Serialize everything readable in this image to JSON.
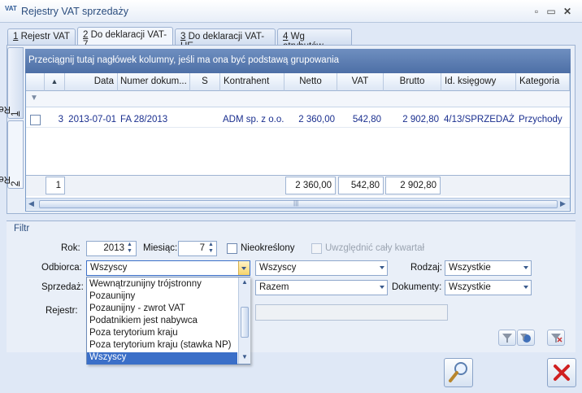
{
  "window": {
    "logo": "VAT",
    "title": "Rejestry VAT sprzedaży"
  },
  "tabs": [
    {
      "num": "1",
      "label": " Rejestr VAT"
    },
    {
      "num": "2",
      "label": " Do deklaracji VAT-7"
    },
    {
      "num": "3",
      "label": " Do deklaracji VAT-UE"
    },
    {
      "num": "4",
      "label": " Wg atrybutów"
    }
  ],
  "side_tabs": [
    {
      "num": "1",
      "label": " Rejestr zak."
    },
    {
      "num": "2",
      "label": " Rejestr spr."
    }
  ],
  "grid": {
    "group_hint": "Przeciągnij tutaj nagłówek kolumny, jeśli ma ona być podstawą grupowania",
    "sort_glyph": "▲",
    "columns": [
      "Data",
      "Numer dokum...",
      "S",
      "Kontrahent",
      "Netto",
      "VAT",
      "Brutto",
      "Id. księgowy",
      "Kategoria"
    ],
    "rows": [
      {
        "lp": "3",
        "data": "2013-07-01",
        "numer": "FA 28/2013",
        "s": "",
        "kontrahent": "ADM sp. z o.o.",
        "netto": "2 360,00",
        "vat": "542,80",
        "brutto": "2 902,80",
        "id": "4/13/SPRZEDAŻ",
        "kategoria": "Przychody"
      }
    ],
    "summary": {
      "count": "1",
      "netto": "2 360,00",
      "vat": "542,80",
      "brutto": "2 902,80"
    }
  },
  "filter": {
    "title": "Filtr",
    "rok_label": "Rok:",
    "rok_value": "2013",
    "miesiac_label": "Miesiąc:",
    "miesiac_value": "7",
    "nieokreslony_label": "Nieokreślony",
    "kwartal_label": "Uwzględnić cały kwartał",
    "odbiorca_label": "Odbiorca:",
    "odbiorca_value": "Wszyscy",
    "odbiorca2_value": "Wszyscy",
    "rodzaj_label": "Rodzaj:",
    "rodzaj_value": "Wszystkie",
    "sprzedaz_label": "Sprzedaż:",
    "razem_value": "Razem",
    "dokumenty_label": "Dokumenty:",
    "dokumenty_value": "Wszystkie",
    "rejestr_label": "Rejestr:",
    "dropdown_options": [
      "Wewnątrzunijny trójstronny",
      "Pozaunijny",
      "Pozaunijny - zwrot VAT",
      "Podatnikiem jest nabywca",
      "Poza terytorium kraju",
      "Poza terytorium kraju (stawka NP)",
      "Wszyscy"
    ],
    "dropdown_selected": "Wszyscy"
  },
  "icons": [
    "search-icon",
    "close-icon",
    "filter-icon",
    "clear-filter-icon",
    "minimize-icon",
    "maximize-icon"
  ],
  "colors": {
    "accent": "#3b6fc8",
    "header": "#5677ae",
    "close": "#d02020"
  }
}
